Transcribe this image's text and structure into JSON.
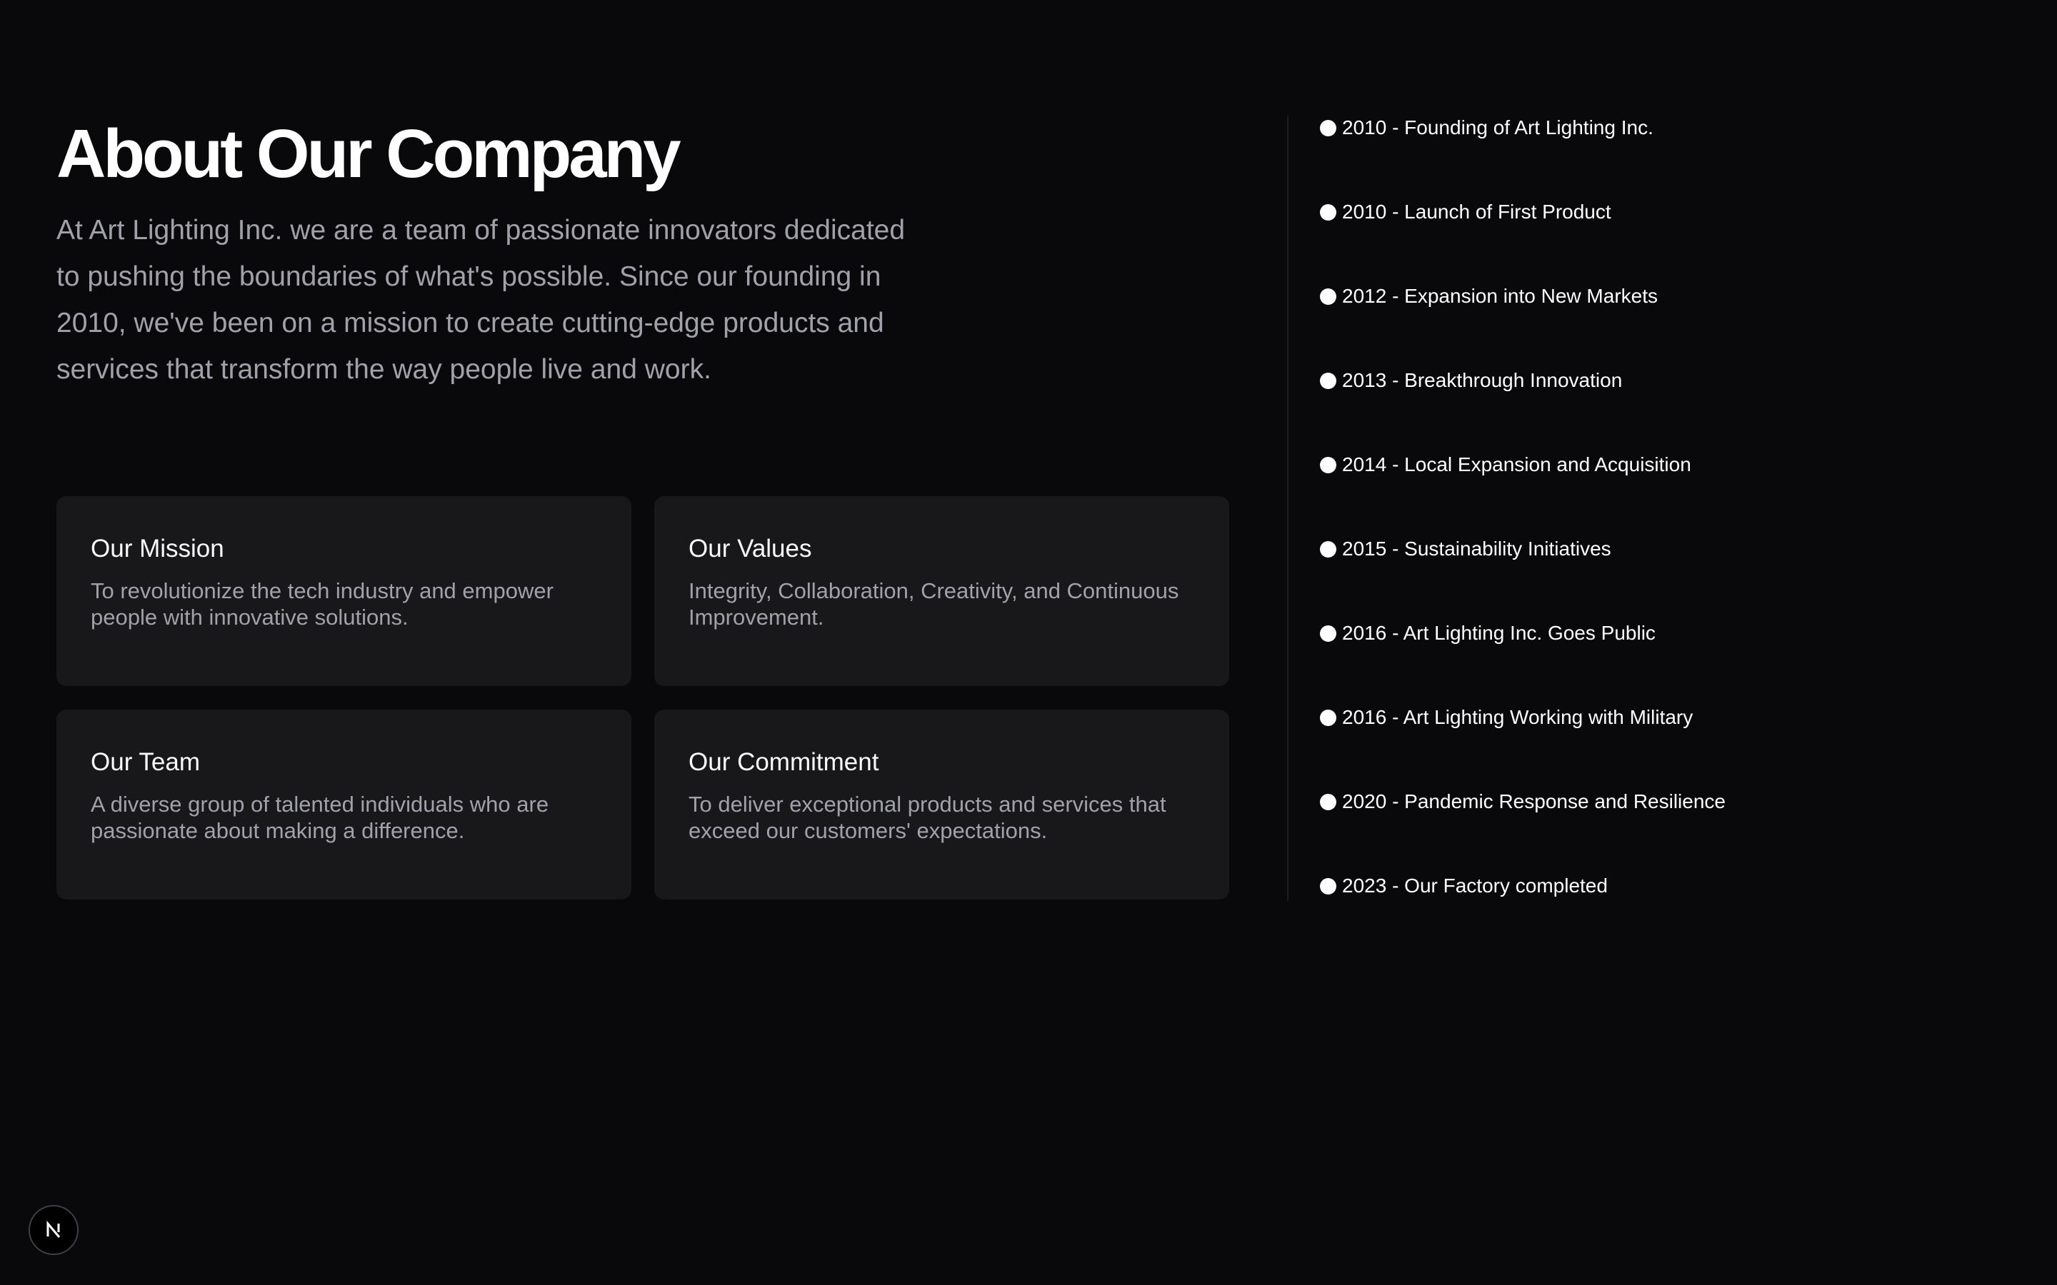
{
  "header": {
    "title": "About Our Company",
    "intro": "At Art Lighting Inc. we are a team of passionate innovators dedicated to pushing the boundaries of what's possible. Since our founding in 2010, we've been on a mission to create cutting-edge products and services that transform the way people live and work."
  },
  "cards": [
    {
      "title": "Our Mission",
      "text": "To revolutionize the tech industry and empower people with innovative solutions."
    },
    {
      "title": "Our Values",
      "text": "Integrity, Collaboration, Creativity, and Continuous Improvement."
    },
    {
      "title": "Our Team",
      "text": "A diverse group of talented individuals who are passionate about making a difference."
    },
    {
      "title": "Our Commitment",
      "text": "To deliver exceptional products and services that exceed our customers' expectations."
    }
  ],
  "timeline": [
    "2010 - Founding of Art Lighting Inc.",
    "2010 - Launch of First Product",
    "2012 - Expansion into New Markets",
    "2013 - Breakthrough Innovation",
    "2014 - Local Expansion and Acquisition",
    "2015 - Sustainability Initiatives",
    "2016 - Art Lighting Inc. Goes Public",
    "2016 - Art Lighting Working with Military",
    "2020 - Pandemic Response and Resilience",
    "2023 - Our Factory completed"
  ],
  "badge": {
    "icon": "nextjs-logo-icon"
  },
  "colors": {
    "background": "#09090b",
    "card": "#18181b",
    "muted_text": "#a1a1aa",
    "text": "#fafafa"
  }
}
